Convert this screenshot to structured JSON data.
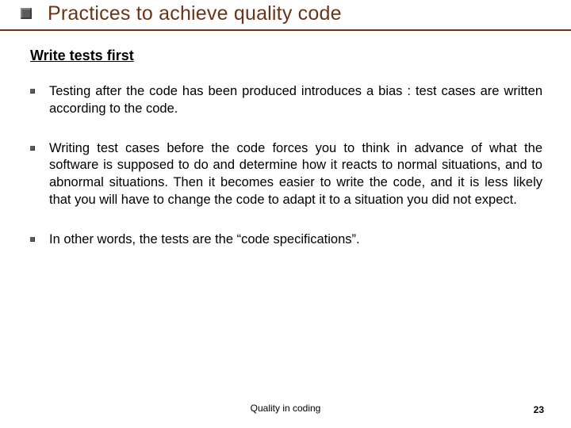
{
  "title": "Practices to achieve quality code",
  "subtitle": "Write tests first",
  "bullets": [
    "Testing after the code has been produced introduces a bias : test cases are written according to the code.",
    "Writing test cases before the code forces you to think in advance of what the software is supposed to do and determine how it reacts to normal situations, and to abnormal situations. Then it becomes easier to write the code, and it is less likely that you will have to change the code to adapt it to a situation you did not expect.",
    "In other words, the tests are the “code specifications”."
  ],
  "footer": {
    "center": "Quality in coding",
    "page_number": "23"
  }
}
